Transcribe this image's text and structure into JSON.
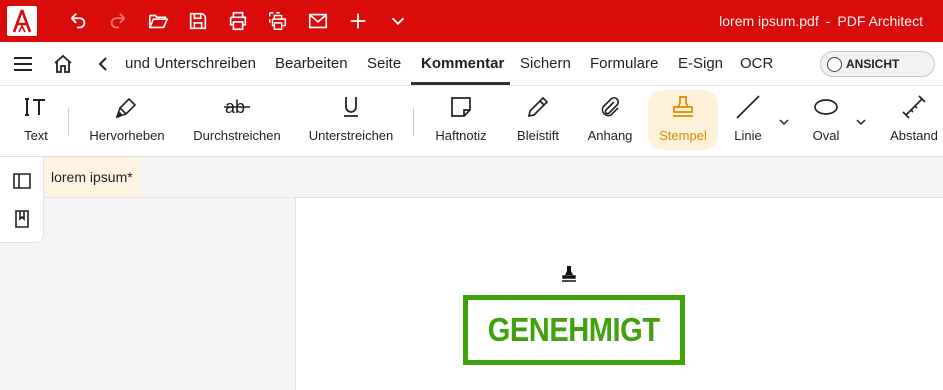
{
  "titlebar": {
    "file_name": "lorem ipsum.pdf",
    "separator": "-",
    "app_name": "PDF Architect",
    "quick_access": [
      {
        "name": "undo-icon"
      },
      {
        "name": "redo-icon"
      },
      {
        "name": "open-folder-icon"
      },
      {
        "name": "save-icon"
      },
      {
        "name": "print-icon"
      },
      {
        "name": "scan-icon"
      },
      {
        "name": "mail-icon"
      },
      {
        "name": "new-plus-icon"
      },
      {
        "name": "chevron-down-icon"
      }
    ]
  },
  "menubar": {
    "tabs": [
      {
        "label": "und Unterschreiben"
      },
      {
        "label": "Bearbeiten"
      },
      {
        "label": "Seite"
      },
      {
        "label": "Kommentar",
        "active": true
      },
      {
        "label": "Sichern"
      },
      {
        "label": "Formulare"
      },
      {
        "label": "E-Sign"
      },
      {
        "label": "OCR"
      }
    ],
    "view_toggle_label": "ANSICHT"
  },
  "ribbon": {
    "tools": [
      {
        "label": "Text",
        "icon": "text-cursor-icon"
      },
      {
        "label": "Hervorheben",
        "icon": "highlighter-icon"
      },
      {
        "label": "Durchstreichen",
        "icon": "strikethrough-icon"
      },
      {
        "label": "Unterstreichen",
        "icon": "underline-icon"
      },
      {
        "label": "Haftnotiz",
        "icon": "sticky-note-icon"
      },
      {
        "label": "Bleistift",
        "icon": "pencil-icon"
      },
      {
        "label": "Anhang",
        "icon": "paperclip-icon"
      },
      {
        "label": "Stempel",
        "icon": "stamp-icon",
        "active": true
      },
      {
        "label": "Linie",
        "icon": "line-icon"
      },
      {
        "label": "Oval",
        "icon": "oval-icon"
      },
      {
        "label": "Abstand",
        "icon": "measure-icon"
      }
    ]
  },
  "document": {
    "tab_label": "lorem ipsum",
    "modified_marker": "*",
    "stamp_text": "GENEHMIGT"
  },
  "colors": {
    "brand_red": "#d90b0b",
    "active_tool": "#e08a00",
    "stamp_green": "#3fa10c"
  }
}
